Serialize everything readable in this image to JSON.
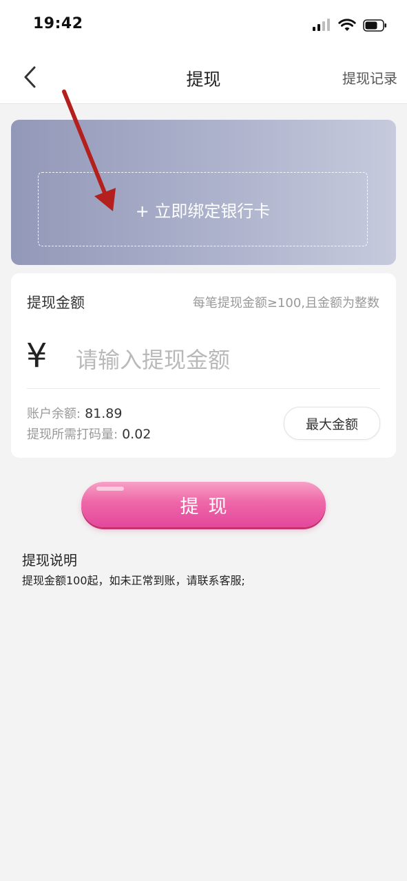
{
  "status_bar": {
    "time": "19:42",
    "icons": [
      "cellular-signal-icon",
      "wifi-icon",
      "battery-icon"
    ]
  },
  "nav": {
    "back_icon": "chevron-left-icon",
    "title": "提现",
    "record_link": "提现记录"
  },
  "bank_card": {
    "bind_label": "+ 立即绑定银行卡",
    "gradient_colors": [
      "#9298b7",
      "#c6cadc"
    ]
  },
  "amount": {
    "label": "提现金额",
    "hint": "每笔提现金额≥100,且金额为整数",
    "currency_symbol": "¥",
    "placeholder": "请输入提现金额",
    "value": "",
    "balance_label": "账户余额:",
    "balance_value": "81.89",
    "turnover_label": "提现所需打码量:",
    "turnover_value": "0.02",
    "max_button": "最大金额"
  },
  "submit": {
    "label": "提现",
    "color": "#ee67a8"
  },
  "notes": {
    "title": "提现说明",
    "text": "提现金额100起，如未正常到账，请联系客服;"
  },
  "annotation": {
    "arrow_color": "#b3201d"
  }
}
